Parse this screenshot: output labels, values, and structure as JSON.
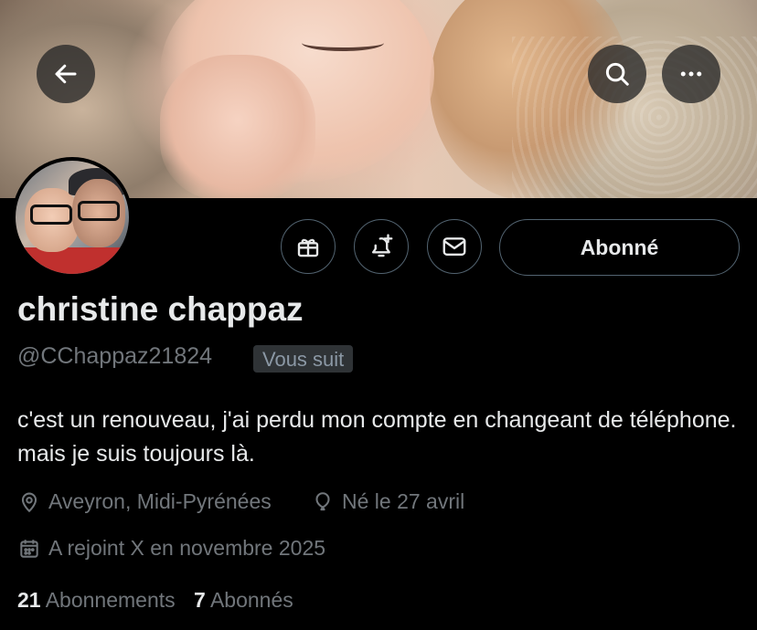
{
  "profile": {
    "name": "christine chappaz",
    "handle": "@CChappaz21824",
    "follows_you": "Vous suit",
    "bio": "c'est un renouveau, j'ai perdu mon compte en changeant de téléphone. mais je suis toujours là.",
    "location": "Aveyron, Midi-Pyrénées",
    "birthday": "Né le 27 avril",
    "joined": "A rejoint X en novembre 2025"
  },
  "actions": {
    "follow_state": "Abonné"
  },
  "stats": {
    "following_count": "21",
    "following_label": "Abonnements",
    "followers_count": "7",
    "followers_label": "Abonnés"
  },
  "icons": {
    "back": "arrow-left-icon",
    "search": "search-icon",
    "more": "more-horizontal-icon",
    "gift": "gift-icon",
    "notify": "bell-plus-icon",
    "message": "envelope-icon",
    "location": "location-pin-icon",
    "birthday": "balloon-icon",
    "joined": "calendar-icon"
  },
  "colors": {
    "background": "#000000",
    "primary_text": "#e7e9ea",
    "secondary_text": "#71767b",
    "border": "#536471",
    "badge_bg": "#2f3336"
  }
}
